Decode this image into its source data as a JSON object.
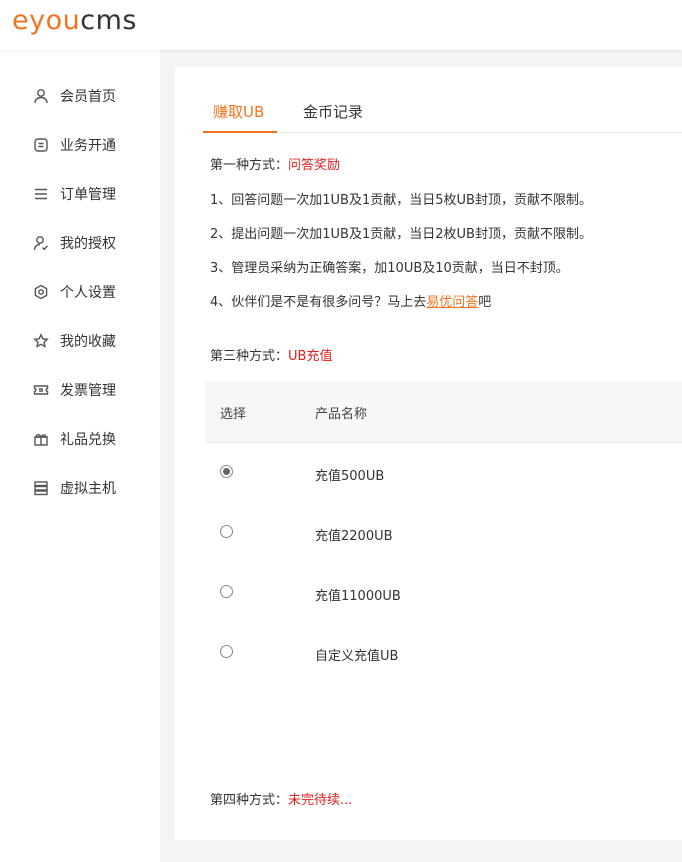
{
  "logo": {
    "accent": "eyou",
    "rest": "cms"
  },
  "sidebar": {
    "items": [
      {
        "label": "会员首页",
        "icon": "user-icon"
      },
      {
        "label": "业务开通",
        "icon": "service-icon"
      },
      {
        "label": "订单管理",
        "icon": "list-icon"
      },
      {
        "label": "我的授权",
        "icon": "user-check-icon"
      },
      {
        "label": "个人设置",
        "icon": "settings-icon"
      },
      {
        "label": "我的收藏",
        "icon": "star-icon"
      },
      {
        "label": "发票管理",
        "icon": "ticket-icon"
      },
      {
        "label": "礼品兑换",
        "icon": "gift-icon"
      },
      {
        "label": "虚拟主机",
        "icon": "server-icon"
      }
    ]
  },
  "tabs": [
    {
      "label": "赚取UB",
      "active": true
    },
    {
      "label": "金币记录",
      "active": false
    }
  ],
  "method1": {
    "prefix": "第一种方式：",
    "title": "问答奖励",
    "lines": [
      "1、回答问题一次加1UB及1贡献，当日5枚UB封顶，贡献不限制。",
      "2、提出问题一次加1UB及1贡献，当日2枚UB封顶，贡献不限制。",
      "3、管理员采纳为正确答案，加10UB及10贡献，当日不封顶。"
    ],
    "line4_before": "4、伙伴们是不是有很多问号？马上去",
    "line4_link": "易优问答",
    "line4_after": "吧"
  },
  "method3": {
    "prefix": "第三种方式：",
    "title": "UB充值"
  },
  "table": {
    "headers": [
      "选择",
      "产品名称"
    ],
    "rows": [
      {
        "name": "充值500UB",
        "checked": true
      },
      {
        "name": "充值2200UB",
        "checked": false
      },
      {
        "name": "充值11000UB",
        "checked": false
      },
      {
        "name": "自定义充值UB",
        "checked": false
      }
    ]
  },
  "method4": {
    "prefix": "第四种方式：",
    "title": "未完待续..."
  }
}
